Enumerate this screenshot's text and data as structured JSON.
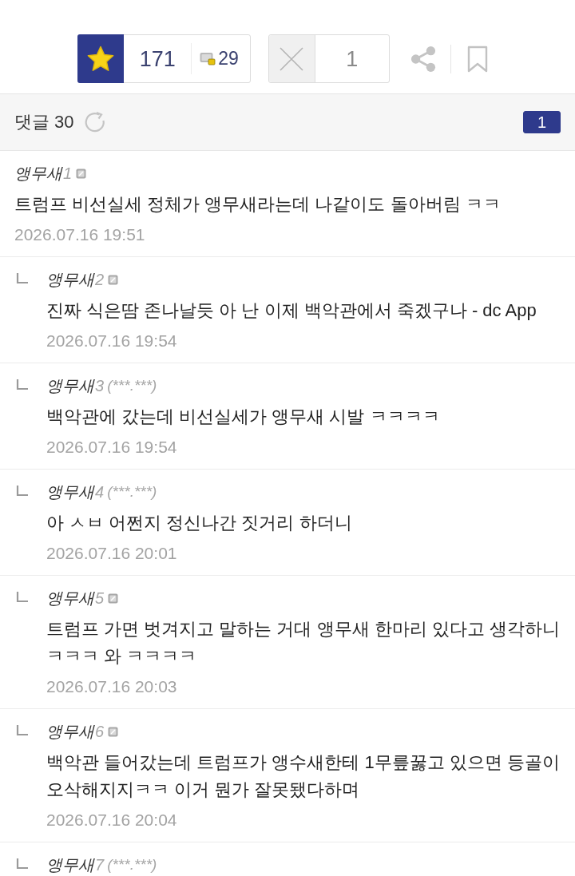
{
  "reactions": {
    "recommend": {
      "count": "171",
      "fixed_count": "29"
    },
    "dislike": {
      "count": "1"
    }
  },
  "comments_header": {
    "label": "댓글 30",
    "pages": [
      {
        "label": "1",
        "selected": true
      }
    ]
  },
  "comments": [
    {
      "kind": "comment",
      "name": "앵무새",
      "number": "1",
      "member_icon": true,
      "text": "트럼프 비선실세 정체가 앵무새라는데 나같이도 돌아버림 ㅋㅋ",
      "date": "2026.07.16 19:51"
    },
    {
      "kind": "reply",
      "name": "앵무새",
      "number": "2",
      "member_icon": true,
      "text": "진짜 식은땀 존나날듯 아 난 이제 백악관에서 죽겠구나 - dc App",
      "date": "2026.07.16 19:54"
    },
    {
      "kind": "reply",
      "name": "앵무새",
      "number": "3",
      "member_icon": false,
      "ip": "(***.***)",
      "text": "백악관에 갔는데 비선실세가 앵무새 시발 ㅋㅋㅋㅋ",
      "date": "2026.07.16 19:54"
    },
    {
      "kind": "reply",
      "name": "앵무새",
      "number": "4",
      "member_icon": false,
      "ip": "(***.***)",
      "text": "아 ㅅㅂ 어쩐지 정신나간 짓거리 하더니",
      "date": "2026.07.16 20:01"
    },
    {
      "kind": "reply",
      "name": "앵무새",
      "number": "5",
      "member_icon": true,
      "text": "트럼프 가면 벗겨지고 말하는 거대 앵무새 한마리 있다고 생각하니 ㅋㅋㅋ 와 ㅋㅋㅋㅋ",
      "date": "2026.07.16 20:03"
    },
    {
      "kind": "reply",
      "name": "앵무새",
      "number": "6",
      "member_icon": true,
      "text": "백악관 들어갔는데 트럼프가 앵수새한테 1무릎꿇고 있으면 등골이 오삭해지지ㅋㅋ 이거 뭔가 잘못됐다하며",
      "date": "2026.07.16 20:04"
    },
    {
      "kind": "reply",
      "name": "앵무새",
      "number": "7",
      "member_icon": false,
      "ip": "(***.***)"
    }
  ]
}
